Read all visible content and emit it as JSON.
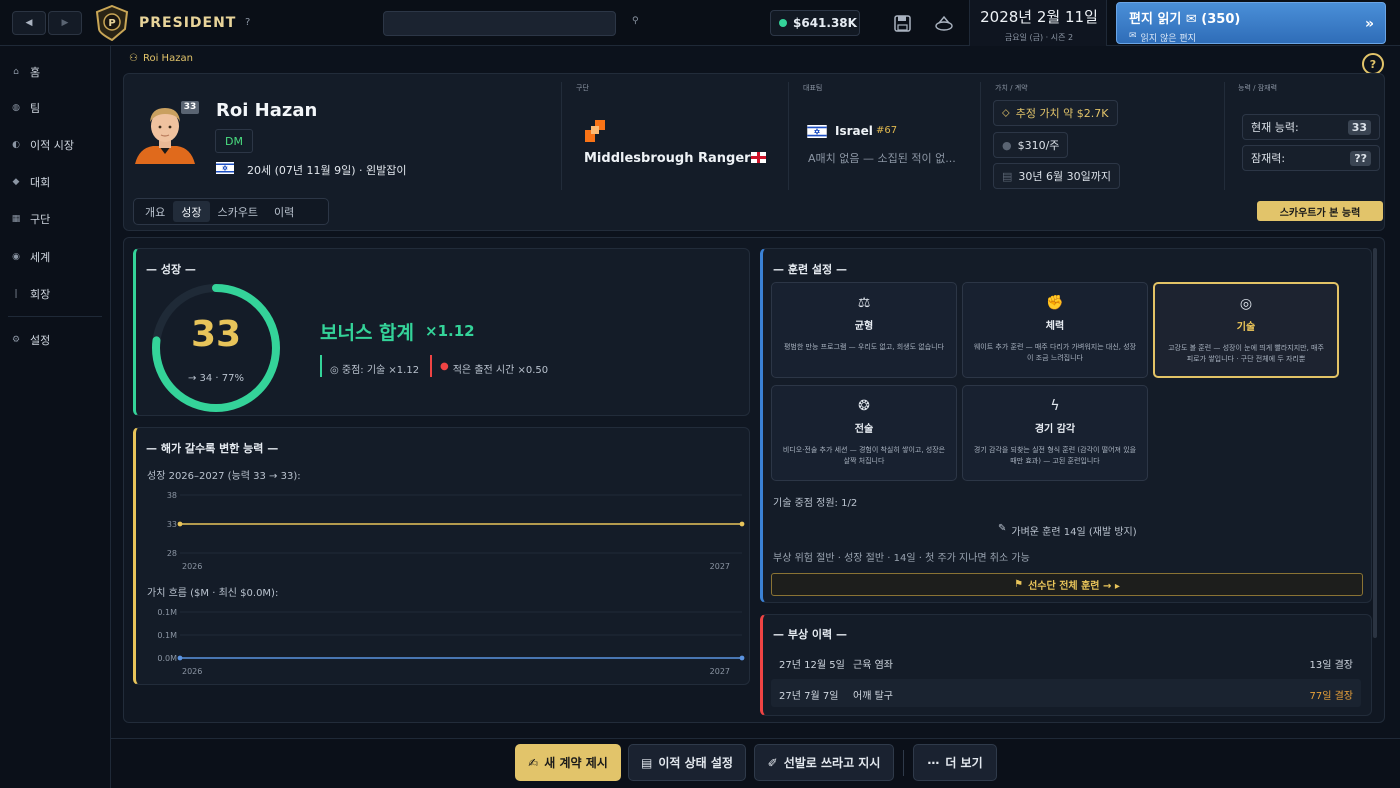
{
  "app": {
    "brand": "PRESIDENT",
    "help": "?"
  },
  "topbar": {
    "back_icon": "back-arrow-icon",
    "forward_icon": "forward-arrow-icon",
    "search_placeholder": "",
    "money": "$641.38K",
    "date": "2028년 2월 11일",
    "day_season": "금요일 (금) · 시즌 2",
    "mail_label": "편지 읽기 ✉ (350)",
    "mail_sub": "읽지 않은 편지",
    "accent_color": "#3b82d6"
  },
  "sidebar": {
    "items": [
      {
        "label": "홈",
        "icon": "home-icon"
      },
      {
        "label": "팀",
        "icon": "team-icon"
      },
      {
        "label": "이적 시장",
        "icon": "transfer-icon"
      },
      {
        "label": "대회",
        "icon": "trophy-icon"
      },
      {
        "label": "구단",
        "icon": "club-icon"
      },
      {
        "label": "세계",
        "icon": "globe-icon"
      },
      {
        "label": "회장",
        "icon": "president-icon"
      },
      {
        "label": "설정",
        "icon": "settings-icon"
      }
    ]
  },
  "breadcrumb": "Roi Hazan",
  "player": {
    "name": "Roi Hazan",
    "number": "33",
    "position": "DM",
    "age_line": "20세 (07년 11월 9일) · 왼발잡이",
    "club_label": "구단",
    "club": "Middlesbrough Rangers",
    "nation_label": "대표팀",
    "nation": "Israel",
    "nation_rank": "#67",
    "nation_caps": "A매치 없음 — 소집된 적이 없...",
    "value_label": "가치 / 계약",
    "value": "추정 가치 약 $2.7K",
    "wage": "$310/주",
    "contract": "30년 6월 30일까지",
    "ability_label": "능력 / 잠재력",
    "current_ability_label": "현재 능력:",
    "current_ability": "33",
    "potential_label": "잠재력:",
    "potential": "??",
    "scout_button": "스카우트가 본 능력"
  },
  "tabs": [
    "개요",
    "성장",
    "스카우트",
    "이력"
  ],
  "growth": {
    "title": "— 성장 —",
    "ability": "33",
    "ability_sub": "→ 34 · 77%",
    "progress_pct": 77,
    "bonus_title": "보너스 합계",
    "bonus_mult": "×1.12",
    "focus": "◎ 중점: 기술 ×1.12",
    "playtime": "적은 출전 시간 ×0.50"
  },
  "yearly": {
    "title": "— 해가 갈수록 변한 능력 —",
    "ability_caption": "성장 2026–2027 (능력 33 → 33):",
    "value_caption": "가치 흐름 ($M · 최신 $0.0M):"
  },
  "chart_data": [
    {
      "type": "line",
      "x": [
        "2026",
        "2027"
      ],
      "values": [
        33,
        33
      ],
      "ylim": [
        28,
        38
      ],
      "yticks": [
        "38",
        "33",
        "28"
      ],
      "color": "#e8c45a"
    },
    {
      "type": "line",
      "x": [
        "2026",
        "2027"
      ],
      "values": [
        0.0,
        0.0
      ],
      "yticks": [
        "0.1M",
        "0.1M",
        "0.0M"
      ],
      "color": "#5b93e0"
    }
  ],
  "training": {
    "title": "— 훈련 설정 —",
    "cards": [
      {
        "title": "균형",
        "icon": "scales-icon",
        "desc": "평범한 만능 프로그램 — 우리도 없고, 희생도 없습니다"
      },
      {
        "title": "체력",
        "icon": "muscle-icon",
        "desc": "웨이트 추가 훈련 — 매주 다리가 가벼워지는 대신, 성장이 조금 느려집니다"
      },
      {
        "title": "기술",
        "icon": "target-icon",
        "desc": "고강도 볼 훈련 — 성장이 눈에 띄게 빨라지지만, 매주 피로가 쌓입니다 · 구단 전체에 두 자리뿐"
      },
      {
        "title": "전술",
        "icon": "brain-icon",
        "desc": "비디오·전술 추가 세션 — 경험이 착실히 쌓이고, 성장은 살짝 처집니다"
      },
      {
        "title": "경기 감각",
        "icon": "lightning-icon",
        "desc": "경기 감각을 되찾는 실전 형식 훈련 (감각이 떨어져 있을 때만 효과) — 고된 훈련입니다"
      }
    ],
    "slots": "기술 중점 정원: 1/2",
    "light_training": "가벼운 훈련 14일 (재발 방지)",
    "light_desc": "부상 위험 절반 · 성장 절반 · 14일 · 첫 주가 지나면 취소 가능",
    "squad_button": "선수단 전체 훈련 → ▸"
  },
  "injuries": {
    "title": "— 부상 이력 —",
    "rows": [
      {
        "date": "27년 12월 5일",
        "type": "근육 염좌",
        "duration": "13일 결장"
      },
      {
        "date": "27년 7월 7일",
        "type": "어깨 탈구",
        "duration": "77일 결장"
      }
    ]
  },
  "actions": {
    "new_contract": "새 계약 제시",
    "transfer_status": "이적 상태 설정",
    "start_order": "선발로 쓰라고 지시",
    "more": "더 보기"
  }
}
